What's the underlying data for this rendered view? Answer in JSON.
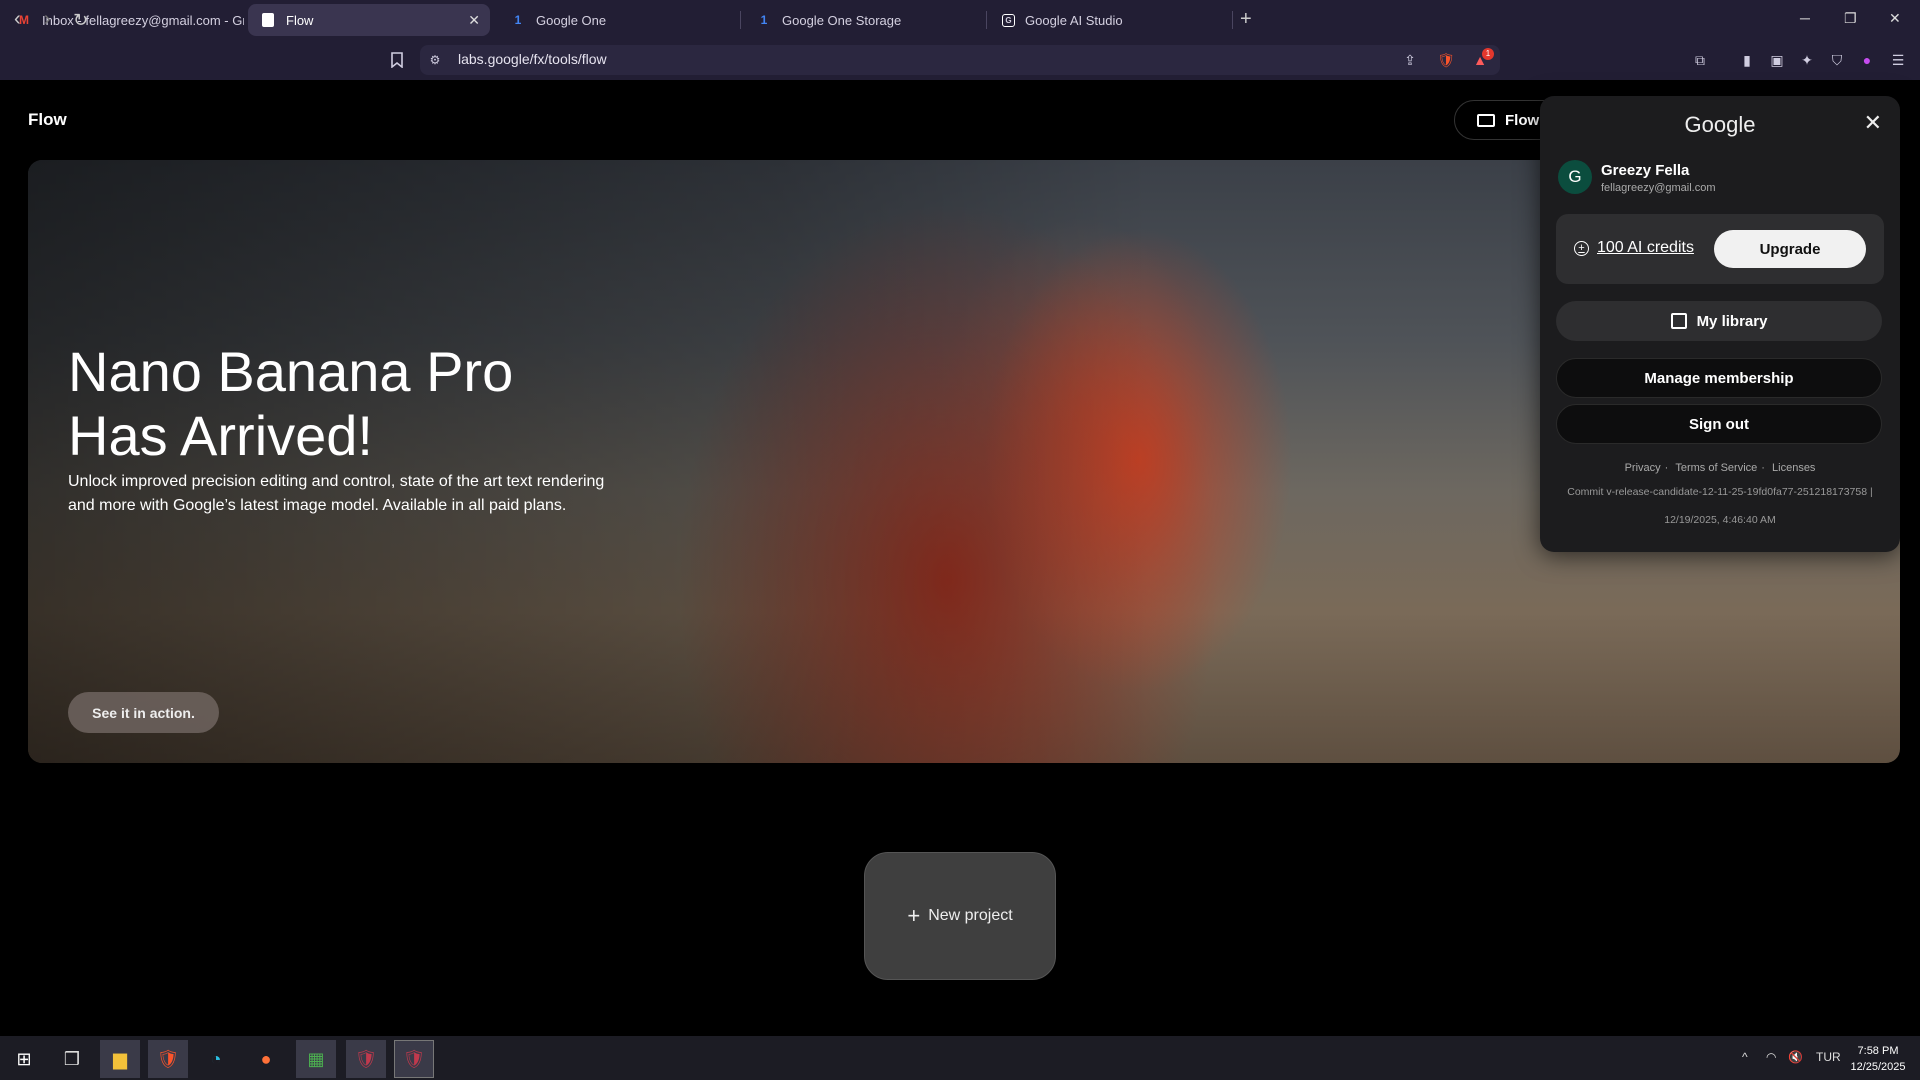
{
  "browser": {
    "tabs": [
      {
        "label": "Inbox - fellagreezy@gmail.com - Gm",
        "icon": "gmail-icon"
      },
      {
        "label": "Flow",
        "icon": "page-icon",
        "active": true
      },
      {
        "label": "Google One",
        "icon": "google-one-icon"
      },
      {
        "label": "Google One Storage",
        "icon": "google-one-icon"
      },
      {
        "label": "Google AI Studio",
        "icon": "ai-studio-icon"
      }
    ],
    "url": "labs.google/fx/tools/flow",
    "shields_badge": "1"
  },
  "page": {
    "brand": "Flow",
    "flow_button": "Flow",
    "hero": {
      "title_line1": "Nano Banana Pro",
      "title_line2": "Has Arrived!",
      "description": "Unlock improved precision editing and control, state of the art text rendering and more with Google’s latest image model. Available in all paid plans.",
      "cta": "See it in action."
    },
    "new_project": "New project"
  },
  "account_popover": {
    "logo": "Google",
    "avatar_letter": "G",
    "name": "Greezy Fella",
    "email": "fellagreezy@gmail.com",
    "credits": "100 AI credits",
    "upgrade": "Upgrade",
    "my_library": "My library",
    "manage_membership": "Manage membership",
    "sign_out": "Sign out",
    "links": {
      "privacy": "Privacy",
      "terms": "Terms of Service",
      "licenses": "Licenses"
    },
    "commit": "Commit v-release-candidate-12-11-25-19fd0fa77-251218173758 |",
    "build_date": "12/19/2025, 4:46:40 AM"
  },
  "taskbar": {
    "language": "TUR",
    "time": "7:58 PM",
    "date": "12/25/2025"
  },
  "colors": {
    "chrome_bg": "#221e34",
    "popover_bg": "#1c1c1e",
    "avatar_bg": "#0b4d3e"
  }
}
